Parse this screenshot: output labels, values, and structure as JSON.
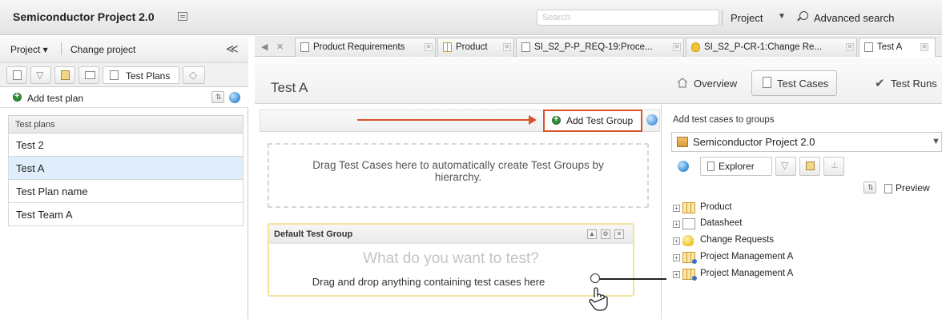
{
  "header": {
    "project_title": "Semiconductor Project 2.0",
    "search_placeholder": "Search",
    "scope": "Project",
    "advanced_search": "Advanced search"
  },
  "left_panel": {
    "project_menu": "Project ▾",
    "change_project": "Change project",
    "collapse": "≪",
    "active_tab": "Test Plans",
    "add_test_plan": "Add test plan",
    "list_header": "Test plans",
    "test_plans": [
      "Test 2",
      "Test A",
      "Test Plan name",
      "Test Team A"
    ],
    "selected_index": 1
  },
  "doc_tabs": [
    {
      "label": "Product Requirements",
      "icon": "doc-icon"
    },
    {
      "label": "Product",
      "icon": "grid-icon"
    },
    {
      "label": "SI_S2_P-P_REQ-19:Proce...",
      "icon": "doc-icon"
    },
    {
      "label": "SI_S2_P-CR-1:Change Re...",
      "icon": "bulb-icon"
    },
    {
      "label": "Test A",
      "icon": "doc-icon"
    }
  ],
  "main": {
    "title": "Test A",
    "views": [
      "Overview",
      "Test Cases",
      "Test Runs"
    ],
    "active_view": "Test Cases",
    "add_test_group": "Add Test Group",
    "drop_hint": "Drag Test Cases here to automatically create Test Groups by hierarchy.",
    "default_group": {
      "title": "Default Test Group",
      "prompt": "What do you want to test?",
      "hint": "Drag and drop anything containing test cases here"
    }
  },
  "right_panel": {
    "heading": "Add test cases to groups",
    "project": "Semiconductor Project 2.0",
    "explorer_tab": "Explorer",
    "preview": "Preview",
    "tree": [
      {
        "label": "Product",
        "icon": "grid-icon"
      },
      {
        "label": "Datasheet",
        "icon": "doc-icon"
      },
      {
        "label": "Change Requests",
        "icon": "bulb-icon"
      },
      {
        "label": "Project Management A",
        "icon": "grid-icon"
      },
      {
        "label": "Project Management A",
        "icon": "grid-icon"
      }
    ]
  },
  "colors": {
    "accent_red": "#d9532b",
    "selection_blue": "#dfeefa",
    "add_green": "#2f8d3b"
  }
}
